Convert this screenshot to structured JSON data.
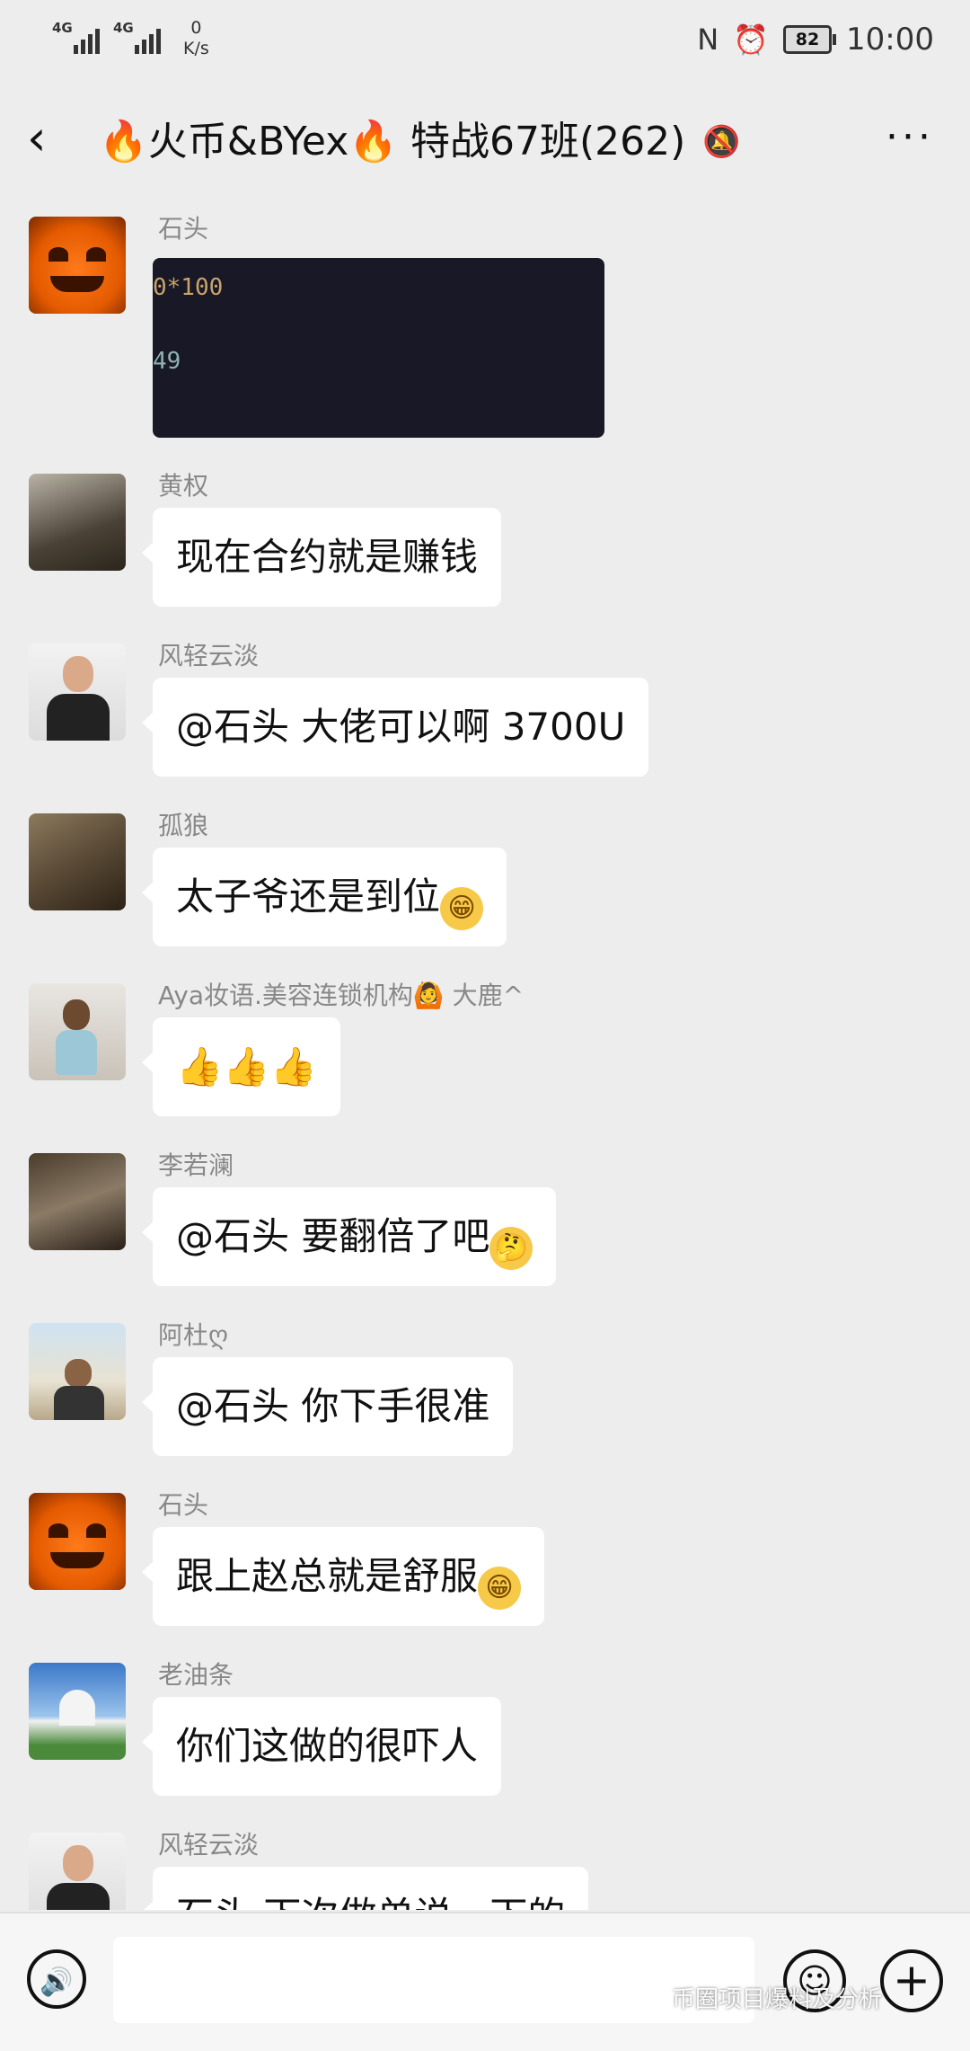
{
  "status_bar": {
    "signal1": "4G",
    "signal2": "4G",
    "net_speed_value": "0",
    "net_speed_unit": "K/s",
    "nfc_icon": "N",
    "alarm_icon": "⏰",
    "battery": "82",
    "time": "10:00"
  },
  "header": {
    "back_icon": "‹",
    "title": "🔥火币&BYex🔥 特战67班(262)",
    "mute_icon": "🔕",
    "more_icon": "···"
  },
  "messages": [
    {
      "name": "石头",
      "image_line1": "0*100",
      "image_line2": "49"
    },
    {
      "name": "黄权",
      "text": "现在合约就是赚钱"
    },
    {
      "name": "风轻云淡",
      "text": "@石头   大佬可以啊   3700U"
    },
    {
      "name": "孤狼",
      "text": "太子爷还是到位",
      "emoji": "😁"
    },
    {
      "name": "Aya妆语.美容连锁机构🙆 大鹿^",
      "text": "👍👍👍"
    },
    {
      "name": "李若澜",
      "text": "@石头  要翻倍了吧",
      "emoji": "🤔"
    },
    {
      "name": "阿杜ღ",
      "text": "@石头  你下手很准"
    },
    {
      "name": "石头",
      "text": "跟上赵总就是舒服",
      "emoji": "😁"
    },
    {
      "name": "老油条",
      "text": "你们这做的很吓人"
    },
    {
      "name": "风轻云淡",
      "text": "石头  下次做单说一下的"
    }
  ],
  "input_bar": {
    "voice_icon": "🔊",
    "emoji_icon": "☺",
    "plus_icon": "+"
  },
  "watermark": "币圈项目爆料及分析",
  "colors": {
    "background": "#ededed",
    "bubble": "#ffffff",
    "name_text": "#888888"
  }
}
